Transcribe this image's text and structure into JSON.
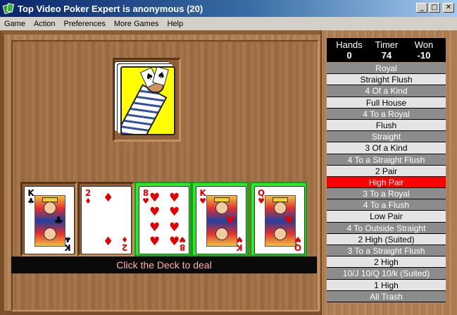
{
  "window": {
    "title": "Top Video Poker Expert is anonymous (20)",
    "minimize": "_",
    "maximize": "□",
    "close": "✕"
  },
  "menu": [
    "Game",
    "Action",
    "Preferences",
    "More Games",
    "Help"
  ],
  "status": "Click the Deck to deal",
  "stats": {
    "hands_label": "Hands",
    "hands": "0",
    "timer_label": "Timer",
    "timer": "74",
    "won_label": "Won",
    "won": "-10"
  },
  "colors": {
    "held": "#2ee62e",
    "active_hand": "#ff0000",
    "status_text": "#ffb0b0"
  },
  "cards": [
    {
      "rank": "K",
      "suit": "♣",
      "color": "black",
      "held": false,
      "face": true
    },
    {
      "rank": "2",
      "suit": "♦",
      "color": "red",
      "held": false,
      "face": false
    },
    {
      "rank": "8",
      "suit": "♥",
      "color": "red",
      "held": true,
      "face": false
    },
    {
      "rank": "K",
      "suit": "♥",
      "color": "red",
      "held": true,
      "face": true
    },
    {
      "rank": "Q",
      "suit": "♥",
      "color": "red",
      "held": true,
      "face": true
    }
  ],
  "paytable": [
    {
      "label": "Royal",
      "style": "dark"
    },
    {
      "label": "Straight Flush",
      "style": "light"
    },
    {
      "label": "4 Of a Kind",
      "style": "dark"
    },
    {
      "label": "Full House",
      "style": "light"
    },
    {
      "label": "4 To a Royal",
      "style": "dark"
    },
    {
      "label": "Flush",
      "style": "light"
    },
    {
      "label": "Straight",
      "style": "dark"
    },
    {
      "label": "3 Of a Kind",
      "style": "light"
    },
    {
      "label": "4 To a Straight Flush",
      "style": "dark"
    },
    {
      "label": "2 Pair",
      "style": "light"
    },
    {
      "label": "High Pair",
      "style": "active"
    },
    {
      "label": "3 To a Royal",
      "style": "dark"
    },
    {
      "label": "4 To a Flush",
      "style": "dark"
    },
    {
      "label": "Low Pair",
      "style": "light"
    },
    {
      "label": "4 To Outside  Straight",
      "style": "dark"
    },
    {
      "label": "2 High (Suited)",
      "style": "light"
    },
    {
      "label": "3 To a Straight Flush",
      "style": "dark"
    },
    {
      "label": "2 High",
      "style": "light"
    },
    {
      "label": "10/J 10/Q 10/k (Suited)",
      "style": "dark"
    },
    {
      "label": "1 High",
      "style": "light"
    },
    {
      "label": "All Trash",
      "style": "dark"
    }
  ]
}
